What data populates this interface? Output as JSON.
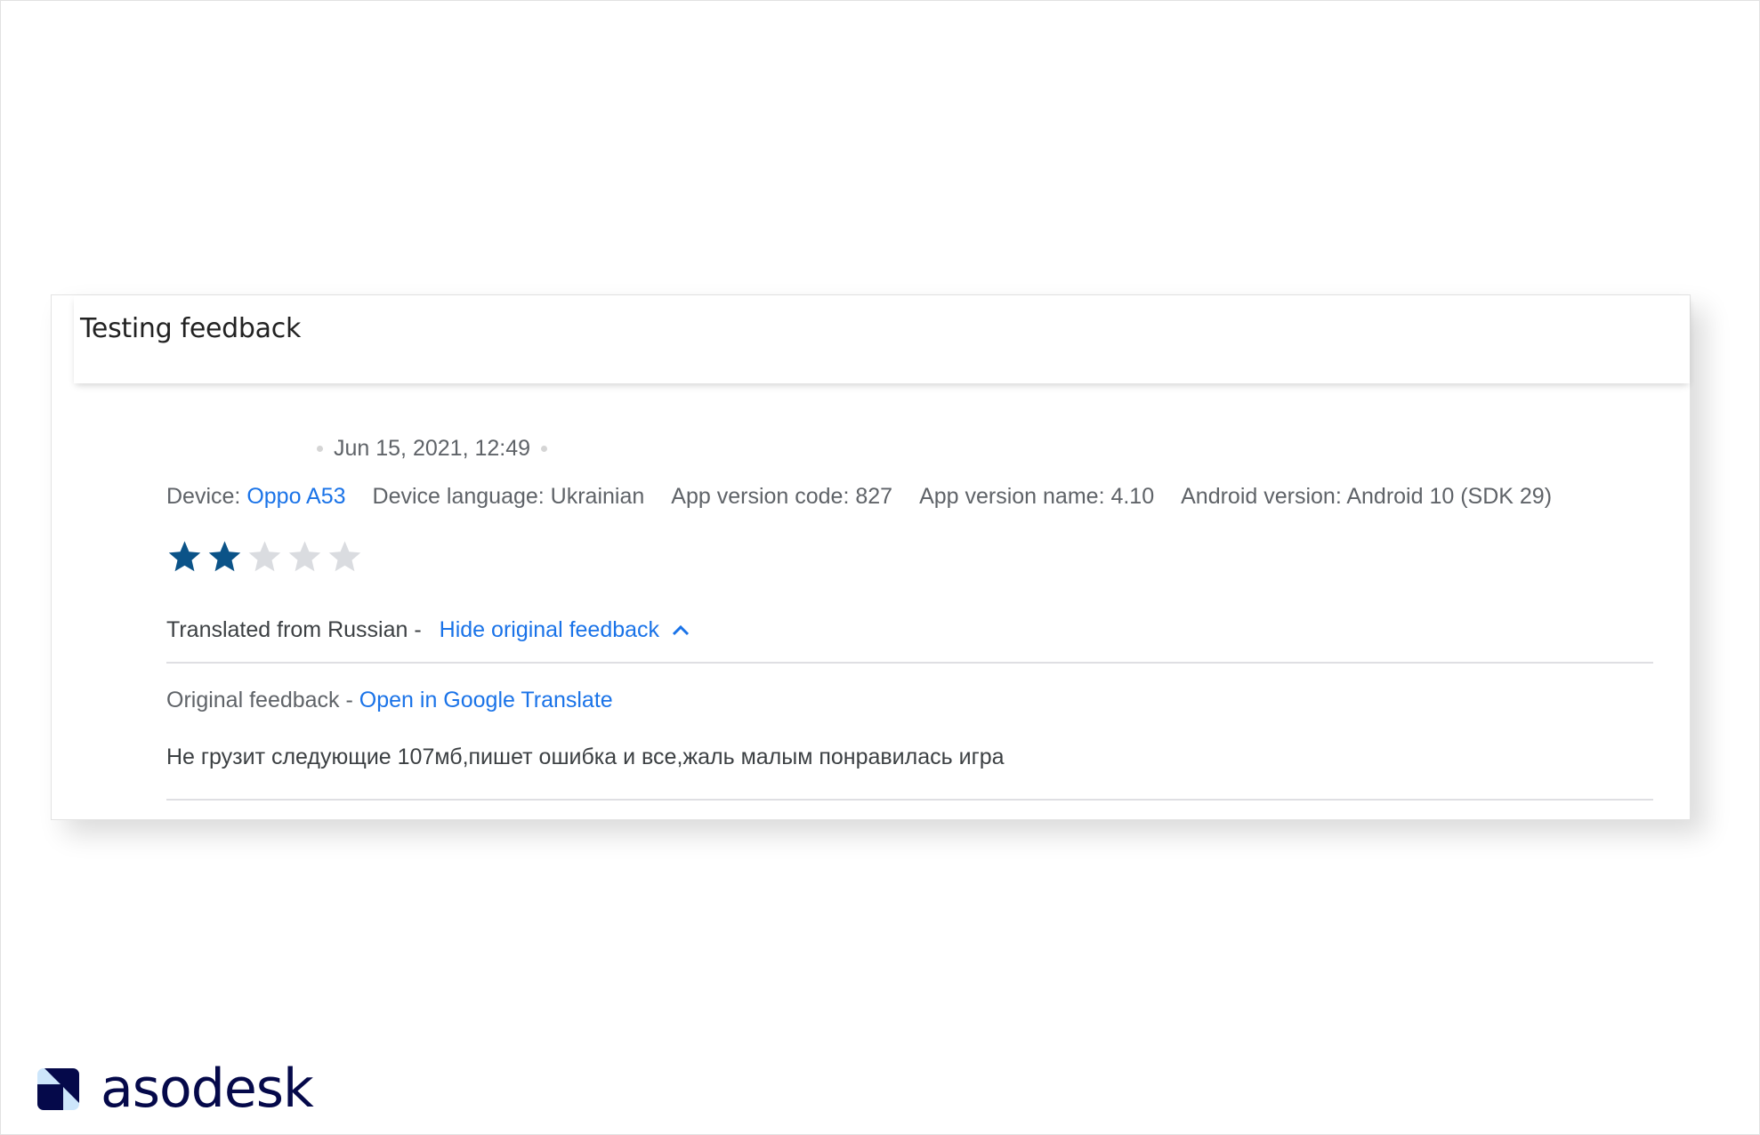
{
  "card": {
    "title": "Testing feedback",
    "timestamp": "Jun 15, 2021, 12:49",
    "device": {
      "device_label": "Device: ",
      "device_value": "Oppo A53",
      "language": "Device language: Ukrainian",
      "version_code": "App version code: 827",
      "version_name": "App version name: 4.10",
      "android_version": "Android version: Android 10 (SDK 29)"
    },
    "rating": {
      "value": 2,
      "max": 5,
      "filled_color": "#0b5388",
      "empty_color": "#dadce0"
    },
    "translation": {
      "translated_from": "Translated from Russian -",
      "toggle_link": "Hide original feedback"
    },
    "original": {
      "label": "Original feedback - ",
      "translate_link": "Open in Google Translate",
      "text": "Не грузит следующие 107мб,пишет ошибка и все,жаль малым понравилась игра"
    }
  },
  "brand": {
    "name": "asodesk"
  },
  "colors": {
    "link": "#1a73e8",
    "brand_dark": "#05094a",
    "brand_light": "#cde6fb"
  }
}
